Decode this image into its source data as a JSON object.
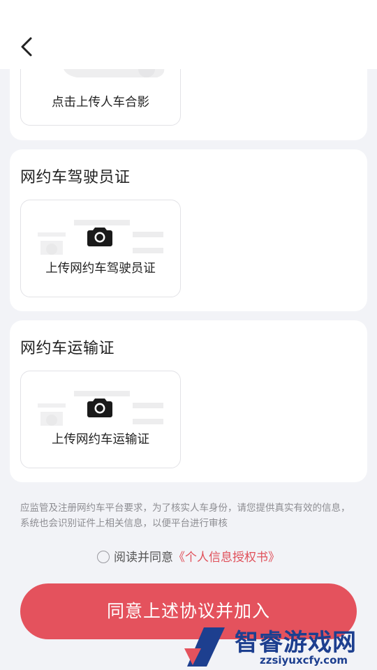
{
  "header": {
    "back_icon": "chevron-left-icon"
  },
  "sections": [
    {
      "upload_label": "点击上传人车合影"
    },
    {
      "title": "网约车驾驶员证",
      "upload_label": "上传网约车驾驶员证"
    },
    {
      "title": "网约车运输证",
      "upload_label": "上传网约车运输证"
    }
  ],
  "notice": "应监管及注册网约车平台要求，为了核实人车身份，请您提供真实有效的信息，系统也会识别证件上相关信息，以便平台进行审核",
  "agreement": {
    "prefix": "阅读并同意",
    "link": "《个人信息授权书》",
    "checked": false
  },
  "submit_label": "同意上述协议并加入",
  "watermark": {
    "brand": "智睿游戏网",
    "url": "zzsiyuxcfy.com"
  },
  "colors": {
    "accent": "#e4525d",
    "link": "#e0505a",
    "background": "#f2f3f7"
  }
}
